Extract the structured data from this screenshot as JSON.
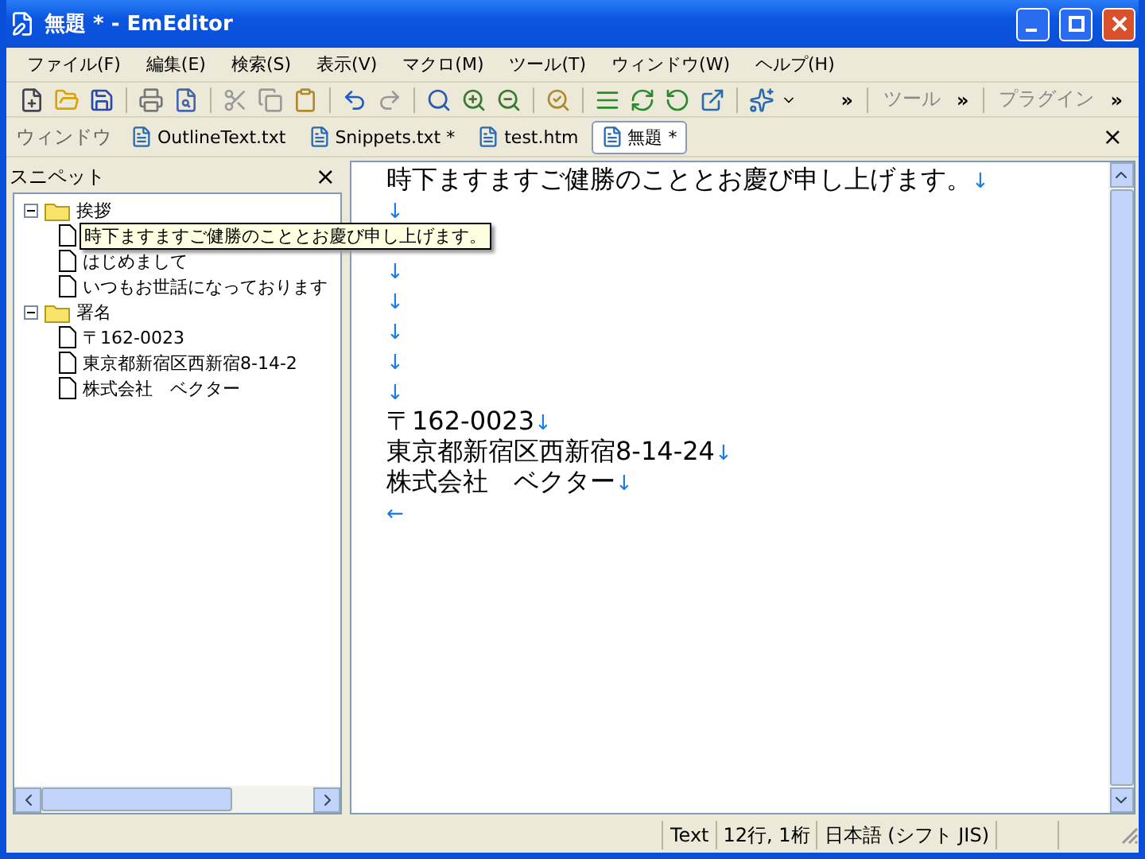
{
  "window": {
    "title": "無題 * - EmEditor"
  },
  "menu": [
    "ファイル(F)",
    "編集(E)",
    "検索(S)",
    "表示(V)",
    "マクロ(M)",
    "ツール(T)",
    "ウィンドウ(W)",
    "ヘルプ(H)"
  ],
  "toolbar": {
    "more": "»",
    "groups": [
      {
        "label": "ツール",
        "more": "»"
      },
      {
        "label": "プラグイン",
        "more": "»"
      }
    ]
  },
  "doc_tabs": {
    "label": "ウィンドウ",
    "close": "×",
    "tabs": [
      {
        "label": "OutlineText.txt",
        "selected": false
      },
      {
        "label": "Snippets.txt *",
        "selected": false
      },
      {
        "label": "test.htm",
        "selected": false
      },
      {
        "label": "無題 *",
        "selected": true
      }
    ]
  },
  "snippets": {
    "title": "スニペット",
    "close": "×",
    "tree": [
      {
        "label": "挨拶",
        "expanded": true,
        "children": [
          {
            "label": "時下ますますご健勝のこととお慶び申し上げます。",
            "tooltip": true
          },
          {
            "label": "はじめまして"
          },
          {
            "label": "いつもお世話になっております"
          }
        ]
      },
      {
        "label": "署名",
        "expanded": true,
        "children": [
          {
            "label": "〒162-0023"
          },
          {
            "label": "東京都新宿区西新宿8-14-2"
          },
          {
            "label": "株式会社　ベクター"
          }
        ]
      }
    ]
  },
  "editor": {
    "lines": [
      {
        "text": "時下ますますご健勝のこととお慶び申し上げます。",
        "mark": "↓"
      },
      {
        "mark": "↓"
      },
      {
        "mark": "↓",
        "gap_before": true
      },
      {
        "mark": "↓"
      },
      {
        "mark": "↓"
      },
      {
        "mark": "↓"
      },
      {
        "mark": "↓"
      },
      {
        "text": "〒162-0023",
        "mark": "↓"
      },
      {
        "text": "東京都新宿区西新宿8-14-24",
        "mark": "↓"
      },
      {
        "text": "株式会社　ベクター",
        "mark": "↓"
      },
      {
        "mark": "←"
      }
    ]
  },
  "status_bar": [
    "Text",
    "12行, 1桁",
    "日本語 (シフト JIS)"
  ]
}
